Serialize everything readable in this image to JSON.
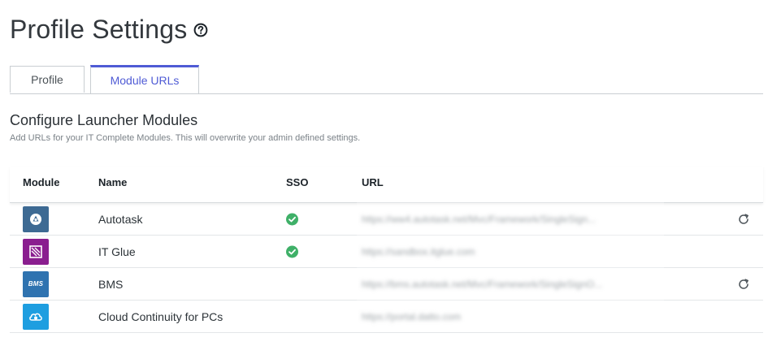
{
  "page": {
    "title": "Profile Settings",
    "help_icon": "question-circle-icon"
  },
  "tabs": [
    {
      "label": "Profile",
      "active": false
    },
    {
      "label": "Module URLs",
      "active": true
    }
  ],
  "section": {
    "title": "Configure Launcher Modules",
    "subtitle": "Add URLs for your IT Complete Modules. This will overwrite your admin defined settings."
  },
  "table": {
    "headers": {
      "module": "Module",
      "name": "Name",
      "sso": "SSO",
      "url": "URL"
    },
    "rows": [
      {
        "icon": "autotask-logo-icon",
        "logo_color": "#3d6a93",
        "name": "Autotask",
        "sso": true,
        "url": "https://ww4.autotask.net/Mvc/Framework/SingleSign...",
        "reset": true
      },
      {
        "icon": "it-glue-logo-icon",
        "logo_color": "#8a1e8f",
        "name": "IT Glue",
        "sso": true,
        "url": "https://sandbox.itglue.com",
        "reset": false
      },
      {
        "icon": "bms-logo-icon",
        "logo_color": "#2f73b0",
        "logo_text": "BMS",
        "name": "BMS",
        "sso": false,
        "url": "https://bms.autotask.net/Mvc/Framework/SingleSignO...",
        "reset": true
      },
      {
        "icon": "cloud-continuity-logo-icon",
        "logo_color": "#1e9ee0",
        "name": "Cloud Continuity for PCs",
        "sso": false,
        "url": "https://portal.datto.com",
        "reset": false
      }
    ]
  },
  "colors": {
    "accent": "#4f5bd5",
    "sso_check": "#3fb068",
    "border": "#c9ced2"
  }
}
